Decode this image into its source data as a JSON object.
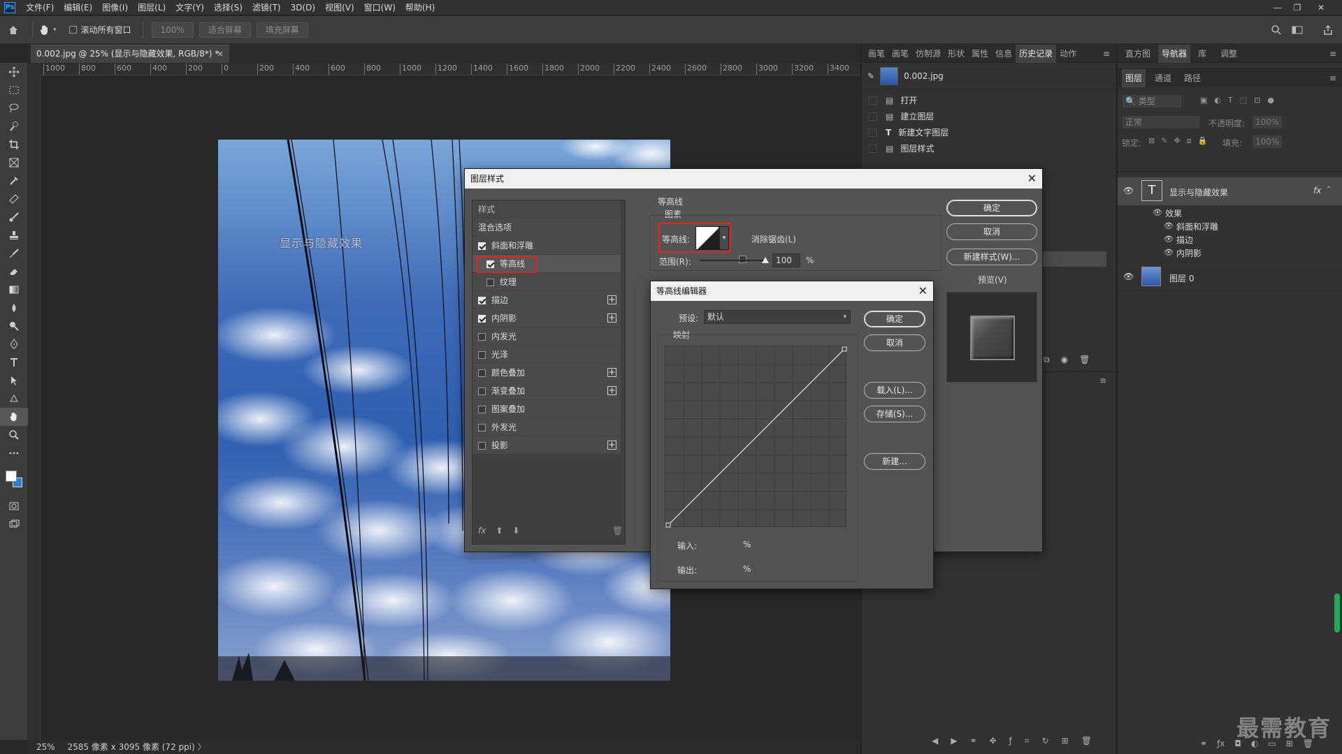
{
  "app": {
    "logo": "Ps",
    "menu": [
      "文件(F)",
      "编辑(E)",
      "图像(I)",
      "图层(L)",
      "文字(Y)",
      "选择(S)",
      "滤镜(T)",
      "3D(D)",
      "视图(V)",
      "窗口(W)",
      "帮助(H)"
    ]
  },
  "options": {
    "scroll_all_label": "滚动所有窗口",
    "zoom_value": "100%",
    "fit_screen": "适合屏幕",
    "fill_screen": "填充屏幕"
  },
  "document": {
    "tab_title": "0.002.jpg @ 25% (显示与隐藏效果, RGB/8*) *",
    "canvas_text": "显示与隐藏效果",
    "zoom": "25%",
    "info": "2585 像素 x 3095 像素 (72 ppi)",
    "ruler_h": [
      "1000",
      "800",
      "600",
      "400",
      "200",
      "0",
      "200",
      "400",
      "600",
      "800",
      "1000",
      "1200",
      "1400",
      "1600",
      "1800",
      "2000",
      "2200",
      "2400",
      "2600",
      "2800",
      "3000",
      "3200",
      "3400"
    ]
  },
  "panel_left": {
    "tabs": [
      "画笔",
      "画笔",
      "仿制源",
      "形状",
      "属性",
      "信息",
      "历史记录",
      "动作"
    ],
    "active_tab": "历史记录",
    "snapshot": "0.002.jpg",
    "history": [
      "打开",
      "建立图层",
      "新建文字图层",
      "图层样式"
    ]
  },
  "panel_right": {
    "tabs": [
      "直方图",
      "导航器",
      "库",
      "调整"
    ],
    "active_tab": "导航器",
    "layer_tabs": [
      "图层",
      "通道",
      "路径"
    ],
    "filter_placeholder": "类型",
    "blend_mode": "正常",
    "opacity_label": "不透明度:",
    "opacity_value": "100%",
    "lock_label": "锁定:",
    "fill_label": "填充:",
    "fill_value": "100%",
    "layers": {
      "text_layer": "显示与隐藏效果",
      "fx_badge": "fx",
      "effects_label": "效果",
      "effects": [
        "斜面和浮雕",
        "描边",
        "内阴影"
      ],
      "image_layer": "图层 0"
    }
  },
  "layer_style_dialog": {
    "title": "图层样式",
    "styles_header": "样式",
    "blend_options": "混合选项",
    "items": [
      {
        "label": "斜面和浮雕",
        "checked": true,
        "plus": false,
        "indent": false
      },
      {
        "label": "等高线",
        "checked": true,
        "plus": false,
        "indent": true
      },
      {
        "label": "纹理",
        "checked": false,
        "plus": false,
        "indent": true
      },
      {
        "label": "描边",
        "checked": true,
        "plus": true,
        "indent": false
      },
      {
        "label": "内阴影",
        "checked": true,
        "plus": true,
        "indent": false
      },
      {
        "label": "内发光",
        "checked": false,
        "plus": false,
        "indent": false
      },
      {
        "label": "光泽",
        "checked": false,
        "plus": false,
        "indent": false
      },
      {
        "label": "颜色叠加",
        "checked": false,
        "plus": true,
        "indent": false
      },
      {
        "label": "渐变叠加",
        "checked": false,
        "plus": true,
        "indent": false
      },
      {
        "label": "图案叠加",
        "checked": false,
        "plus": false,
        "indent": false
      },
      {
        "label": "外发光",
        "checked": false,
        "plus": false,
        "indent": false
      },
      {
        "label": "投影",
        "checked": false,
        "plus": true,
        "indent": false
      }
    ],
    "section_title": "等高线",
    "group_title": "图素",
    "contour_label": "等高线:",
    "antialias_label": "消除锯齿(L)",
    "range_label": "范围(R):",
    "range_value": "100",
    "percent": "%",
    "ok": "确定",
    "cancel": "取消",
    "new_style": "新建样式(W)...",
    "preview": "预览(V)",
    "fx": "fx"
  },
  "contour_editor": {
    "title": "等高线编辑器",
    "preset_label": "预设:",
    "preset_value": "默认",
    "mapping": "映射",
    "input_label": "输入:",
    "output_label": "输出:",
    "percent": "%",
    "ok": "确定",
    "cancel": "取消",
    "load": "载入(L)...",
    "save": "存储(S)...",
    "new": "新建..."
  },
  "watermark": "最需教育",
  "colors": {
    "accent_red": "#e02424",
    "panel": "#323232",
    "dialog": "#535353"
  }
}
